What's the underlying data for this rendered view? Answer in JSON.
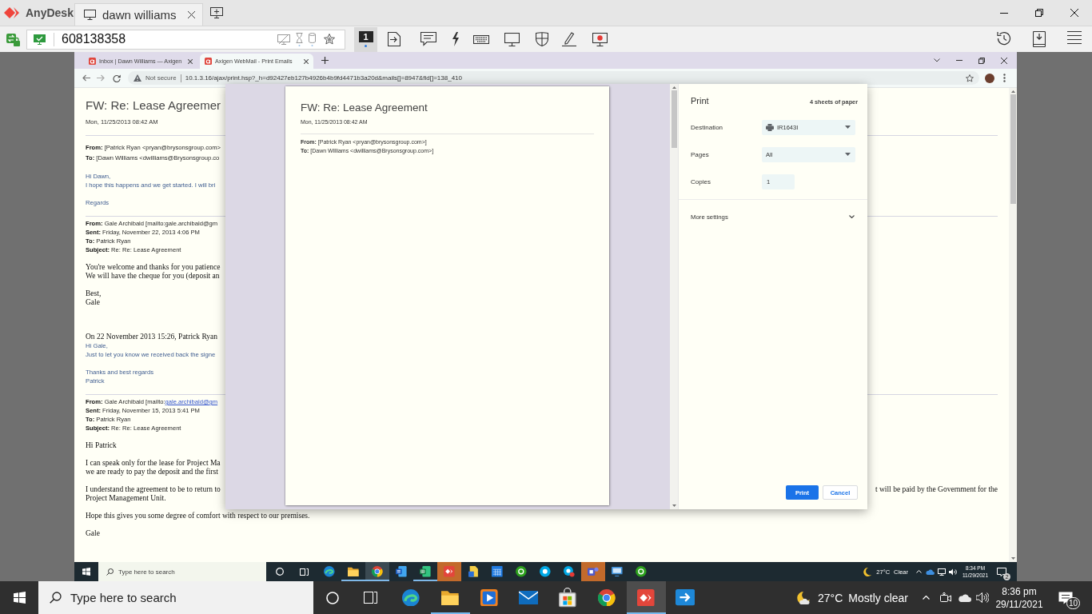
{
  "anydesk": {
    "app_name": "AnyDesk",
    "tabs": [
      {
        "label": "dawn williams",
        "selected": true
      }
    ],
    "address": {
      "value": "608138358"
    },
    "display": "1"
  },
  "browser": {
    "tabs": [
      {
        "label": "Inbox | Dawn Williams — Axigen",
        "selected": false
      },
      {
        "label": "Axigen WebMail - Print Emails",
        "selected": true
      }
    ],
    "security": "Not secure",
    "url": "10.1.3.16/ajax/print.hsp?_h=d92427eb127b4926b4b9fd4471b3a20d&mails[]=8947&fid[]=138_410"
  },
  "email": {
    "title": "FW: Re: Lease Agreemer",
    "date": "Mon, 11/25/2013 08:42 AM",
    "sections": [
      {
        "kind": "rule"
      },
      {
        "kind": "recipients",
        "lines": [
          {
            "label": "From:",
            "value": "[Patrick Ryan <pryan@brysonsgroup.com>"
          },
          {
            "label": "To:",
            "value": "[Dawn Williams <dwilliams@Brysonsgroup.co"
          }
        ]
      },
      {
        "kind": "note",
        "lines": [
          {
            "text": "Hi Dawn,"
          },
          {
            "text": "I hope this happens and we get started. I will bri"
          }
        ]
      },
      {
        "kind": "note",
        "lines": [
          {
            "text": "Regards"
          }
        ]
      },
      {
        "kind": "rule"
      },
      {
        "kind": "headers",
        "lines": [
          {
            "label": "From:",
            "value": "Gale Archibald [mailto:gale.archibald@gm"
          },
          {
            "label": "Sent:",
            "value": "Friday, November 22, 2013 4:06 PM"
          },
          {
            "label": "To:",
            "value": "Patrick Ryan"
          },
          {
            "label": "Subject:",
            "value": "Re: Re: Lease Agreement"
          }
        ]
      },
      {
        "kind": "letter",
        "lines": [
          {
            "text": "You're welcome and thanks for you patience"
          },
          {
            "text": "We will have the cheque for you (deposit an"
          }
        ]
      },
      {
        "kind": "letter",
        "lines": [
          {
            "text": "Best,"
          },
          {
            "text": "Gale"
          }
        ]
      },
      {
        "kind": "quote",
        "intro": "On 22 November 2013 15:26, Patrick Ryan",
        "lines": [
          {
            "text": "Hi Gale,"
          },
          {
            "text": "Just to let you know we received back the signe"
          }
        ]
      },
      {
        "kind": "note",
        "lines": [
          {
            "text": "Thanks and best regards"
          },
          {
            "text": "Patrick"
          }
        ]
      },
      {
        "kind": "rule"
      },
      {
        "kind": "headers",
        "lines": [
          {
            "label": "From:",
            "value": "Gale Archibald [mailto:",
            "link": "gale.archibald@gm"
          },
          {
            "label": "Sent:",
            "value": "Friday, November 15, 2013 5:41 PM"
          },
          {
            "label": "To:",
            "value": "Patrick Ryan"
          },
          {
            "label": "Subject:",
            "value": "Re: Re: Lease Agreement"
          }
        ]
      },
      {
        "kind": "letter",
        "lines": [
          {
            "text": "Hi Patrick"
          }
        ]
      },
      {
        "kind": "letter",
        "lines": [
          {
            "text": "I can speak only for the lease for Project Ma"
          },
          {
            "text": "we are ready to pay the deposit and the first"
          }
        ]
      },
      {
        "kind": "letter",
        "lines": [
          {
            "text": "I understand the agreement to be to return to",
            "text_right": "t will be paid by the Government for the"
          },
          {
            "text": "Project Management Unit."
          }
        ]
      },
      {
        "kind": "letter",
        "lines": [
          {
            "text": "Hope this gives you some degree of comfort with respect to our premises."
          }
        ]
      },
      {
        "kind": "letter",
        "lines": [
          {
            "text": "Gale"
          }
        ]
      }
    ]
  },
  "print_preview": {
    "title": "FW: Re: Lease Agreement",
    "date": "Mon, 11/25/2013 08:42 AM",
    "headers": [
      {
        "label": "From:",
        "value": "[Patrick Ryan <pryan@brysonsgroup.com>]"
      },
      {
        "label": "To:",
        "value": "[Dawn Williams <dwilliams@Brysonsgroup.com>]"
      }
    ]
  },
  "print_settings": {
    "title": "Print",
    "summary": "4 sheets of paper",
    "fields": [
      {
        "kind": "destination",
        "label": "Destination",
        "value": "IR1643I"
      },
      {
        "kind": "select",
        "label": "Pages",
        "value": "All"
      },
      {
        "kind": "number",
        "label": "Copies",
        "value": "1"
      }
    ],
    "more_settings": {
      "label": "More settings",
      "expanded": false
    },
    "buttons": [
      {
        "kind": "primary",
        "label": "Print"
      },
      {
        "kind": "secondary",
        "label": "Cancel"
      }
    ]
  },
  "remote_taskbar": {
    "search": {
      "placeholder": "Type here to search"
    },
    "apps": [
      {
        "active": false,
        "flashing": false,
        "running": false
      },
      {
        "active": false,
        "flashing": false,
        "running": true
      },
      {
        "active": true,
        "flashing": false,
        "running": true
      },
      {
        "active": false,
        "flashing": false,
        "running": false
      },
      {
        "active": false,
        "flashing": false,
        "running": true
      },
      {
        "active": false,
        "flashing": true,
        "running": false
      },
      {
        "active": false,
        "flashing": false,
        "running": false
      },
      {
        "active": false,
        "flashing": false,
        "running": false
      },
      {
        "active": false,
        "flashing": false,
        "running": false
      },
      {
        "active": false,
        "flashing": false,
        "running": false
      },
      {
        "active": false,
        "flashing": false,
        "running": false
      },
      {
        "active": false,
        "flashing": true,
        "running": false
      },
      {
        "active": false,
        "flashing": false,
        "running": false
      },
      {
        "active": false,
        "flashing": false,
        "running": false
      }
    ],
    "weather": {
      "temperature": "27°C",
      "condition": "Clear"
    },
    "clock": {
      "time": "8:34 PM",
      "date": "11/29/2021"
    },
    "notifications": "2"
  },
  "taskbar": {
    "search": {
      "placeholder": "Type here to search"
    },
    "apps": [
      {
        "active": false,
        "flashing": false,
        "running": false
      },
      {
        "active": false,
        "flashing": false,
        "running": true
      },
      {
        "active": false,
        "flashing": false,
        "running": false
      },
      {
        "active": false,
        "flashing": false,
        "running": false
      },
      {
        "active": false,
        "flashing": false,
        "running": false
      },
      {
        "active": false,
        "flashing": false,
        "running": false
      },
      {
        "active": true,
        "flashing": false,
        "running": true
      },
      {
        "active": false,
        "flashing": false,
        "running": false
      }
    ],
    "weather": {
      "temperature": "27°C",
      "condition": "Mostly clear"
    },
    "clock": {
      "time": "8:36 pm",
      "date": "29/11/2021"
    },
    "notifications": "10"
  }
}
